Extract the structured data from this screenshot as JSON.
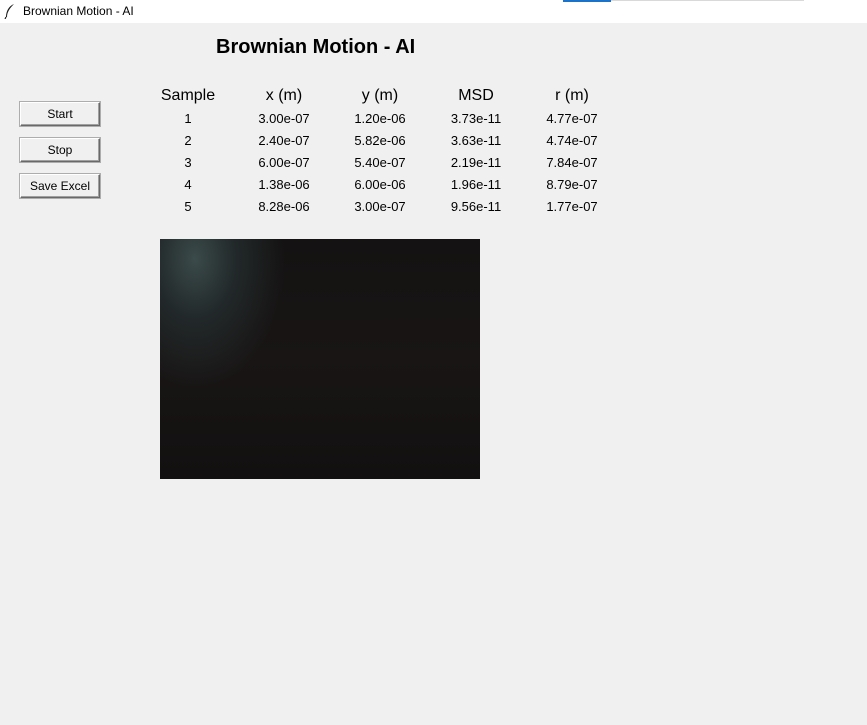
{
  "window": {
    "title": "Brownian Motion - AI",
    "icon": "feather-icon"
  },
  "heading": "Brownian Motion - AI",
  "buttons": {
    "start": "Start",
    "stop": "Stop",
    "save_excel": "Save Excel"
  },
  "table": {
    "headers": [
      "Sample",
      "x (m)",
      "y (m)",
      "MSD",
      "r (m)"
    ],
    "rows": [
      [
        "1",
        "3.00e-07",
        "1.20e-06",
        "3.73e-11",
        "4.77e-07"
      ],
      [
        "2",
        "2.40e-07",
        "5.82e-06",
        "3.63e-11",
        "4.74e-07"
      ],
      [
        "3",
        "6.00e-07",
        "5.40e-07",
        "2.19e-11",
        "7.84e-07"
      ],
      [
        "4",
        "1.38e-06",
        "6.00e-06",
        "1.96e-11",
        "8.79e-07"
      ],
      [
        "5",
        "8.28e-06",
        "3.00e-07",
        "9.56e-11",
        "1.77e-07"
      ]
    ]
  },
  "colors": {
    "background": "#f0f0f0",
    "video_background": "#151313",
    "titlebar_accent": "#1a73c8"
  }
}
